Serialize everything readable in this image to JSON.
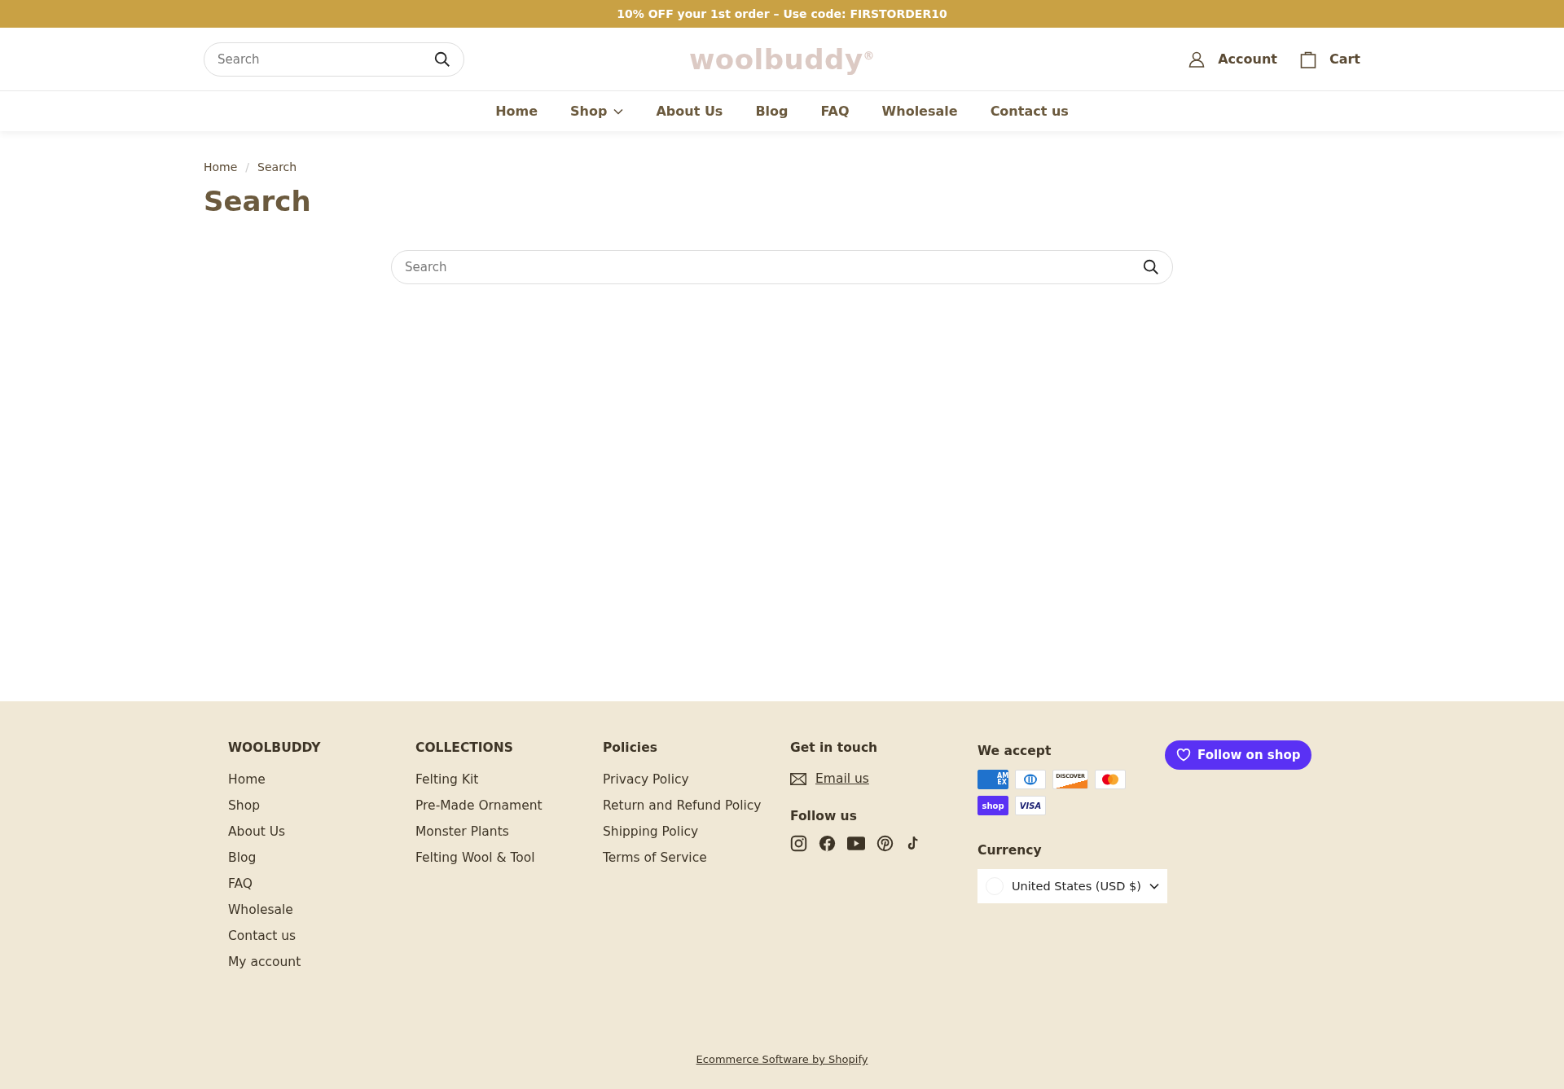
{
  "announcement": "10% OFF your 1st order – Use code: FIRSTORDER10",
  "header": {
    "search": {
      "placeholder": "Search"
    },
    "logo": {
      "text": "woolbuddy",
      "mark": "®"
    },
    "account": "Account",
    "cart": "Cart"
  },
  "nav": [
    {
      "label": "Home",
      "dropdown": false
    },
    {
      "label": "Shop",
      "dropdown": true
    },
    {
      "label": "About Us",
      "dropdown": false
    },
    {
      "label": "Blog",
      "dropdown": false
    },
    {
      "label": "FAQ",
      "dropdown": false
    },
    {
      "label": "Wholesale",
      "dropdown": false
    },
    {
      "label": "Contact us",
      "dropdown": false
    }
  ],
  "breadcrumb": [
    "Home",
    "Search"
  ],
  "breadcrumb_separator": "/",
  "page_title": "Search",
  "search": {
    "placeholder": "Search"
  },
  "footer": {
    "columns": [
      {
        "heading": "WOOLBUDDY",
        "links": [
          "Home",
          "Shop",
          "About Us",
          "Blog",
          "FAQ",
          "Wholesale",
          "Contact us",
          "My account"
        ]
      },
      {
        "heading": "COLLECTIONS",
        "links": [
          "Felting Kit",
          "Pre-Made Ornament",
          "Monster Plants",
          "Felting Wool & Tool"
        ]
      },
      {
        "heading": "Policies",
        "links": [
          "Privacy Policy",
          "Return and Refund Policy",
          "Shipping Policy",
          "Terms of Service"
        ]
      }
    ],
    "contact": {
      "heading": "Get in touch",
      "email": "Email us",
      "follow_heading": "Follow us"
    },
    "payments": {
      "heading": "We accept",
      "methods": [
        {
          "kind": "amex",
          "label": "AM EX"
        },
        {
          "kind": "diners"
        },
        {
          "kind": "discover",
          "label": "DISCOVER"
        },
        {
          "kind": "mastercard"
        },
        {
          "kind": "shop",
          "label": "shop"
        },
        {
          "kind": "visa",
          "label": "VISA"
        }
      ]
    },
    "currency": {
      "heading": "Currency",
      "value": "United States (USD $)"
    },
    "follow_button": "Follow on shop",
    "credit": "Ecommerce Software by Shopify"
  }
}
